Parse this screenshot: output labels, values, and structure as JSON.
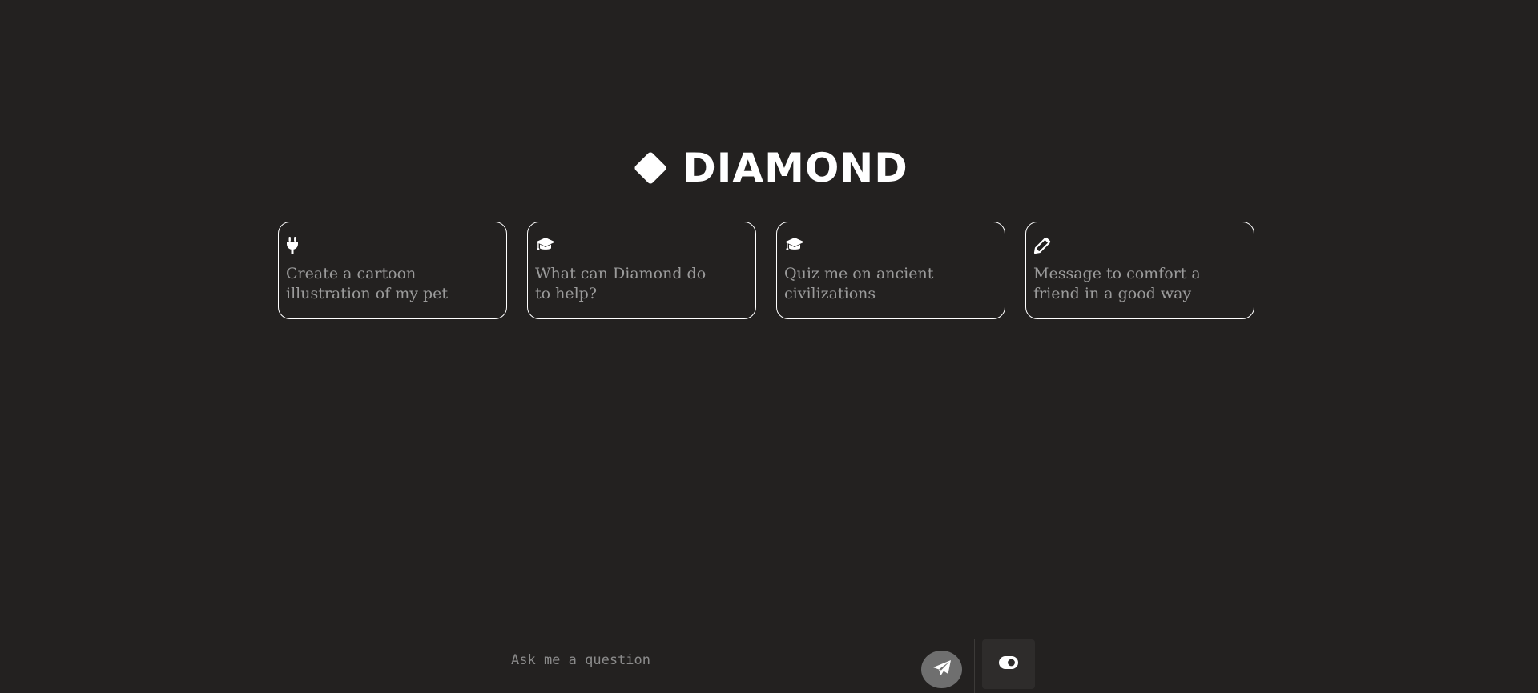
{
  "brand": {
    "name": "DIAMOND",
    "logo_icon": "diamond-icon"
  },
  "suggestions": [
    {
      "icon": "plug-icon",
      "text": "Create a cartoon illustration of my pet"
    },
    {
      "icon": "graduation-cap-icon",
      "text": "What can Diamond do to help?"
    },
    {
      "icon": "graduation-cap-icon",
      "text": "Quiz me on ancient civilizations"
    },
    {
      "icon": "pencil-icon",
      "text": "Message to comfort a friend in a good way"
    }
  ],
  "composer": {
    "placeholder": "Ask me a question",
    "value": "",
    "send_icon": "paper-plane-icon",
    "toggle_icon": "toggle-icon"
  },
  "colors": {
    "background": "#232120",
    "card_border": "#ffffff",
    "card_text": "#9b9b9b",
    "send_button": "#6f6f6f",
    "toggle_button": "#2e2c2b"
  }
}
